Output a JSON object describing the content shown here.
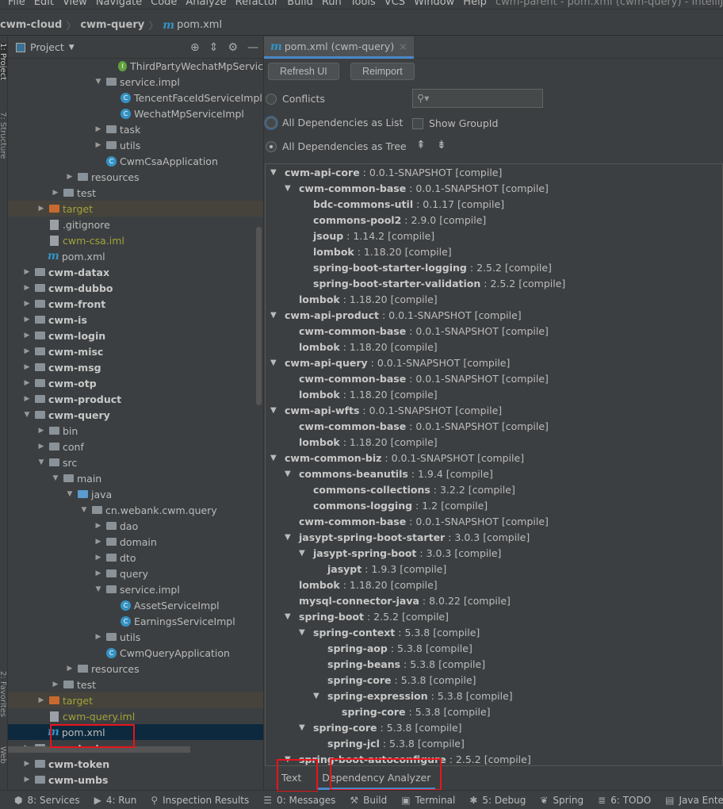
{
  "menu": {
    "items": [
      "File",
      "Edit",
      "View",
      "Navigate",
      "Code",
      "Analyze",
      "Refactor",
      "Build",
      "Run",
      "Tools",
      "VCS",
      "Window",
      "Help"
    ],
    "window_title": "cwm-parent - pom.xml (cwm-query) - IntelliJ IDEA"
  },
  "breadcrumb": [
    "cwm-cloud",
    "cwm-query",
    "pom.xml"
  ],
  "side_stripe": [
    "1: Project",
    "7: Structure",
    "2: Favorites",
    "Web"
  ],
  "project": {
    "title": "Project",
    "rows": [
      {
        "d": 7,
        "t": "iface",
        "label": "ThirdPartyWechatMpServic"
      },
      {
        "d": 6,
        "t": "folder",
        "open": true,
        "label": "service.impl"
      },
      {
        "d": 7,
        "t": "class",
        "label": "TencentFaceIdServiceImpl"
      },
      {
        "d": 7,
        "t": "class",
        "label": "WechatMpServiceImpl"
      },
      {
        "d": 6,
        "t": "folder",
        "open": false,
        "label": "task"
      },
      {
        "d": 6,
        "t": "folder",
        "open": false,
        "label": "utils"
      },
      {
        "d": 6,
        "t": "app",
        "label": "CwmCsaApplication"
      },
      {
        "d": 4,
        "t": "folder",
        "open": false,
        "label": "resources"
      },
      {
        "d": 3,
        "t": "folder",
        "open": false,
        "label": "test"
      },
      {
        "d": 2,
        "t": "target",
        "open": false,
        "label": "target"
      },
      {
        "d": 2,
        "t": "file",
        "label": ".gitignore"
      },
      {
        "d": 2,
        "t": "iml",
        "label": "cwm-csa.iml"
      },
      {
        "d": 2,
        "t": "pom",
        "label": "pom.xml"
      },
      {
        "d": 1,
        "t": "module",
        "open": false,
        "label": "cwm-datax"
      },
      {
        "d": 1,
        "t": "module",
        "open": false,
        "label": "cwm-dubbo"
      },
      {
        "d": 1,
        "t": "module",
        "open": false,
        "label": "cwm-front"
      },
      {
        "d": 1,
        "t": "module",
        "open": false,
        "label": "cwm-is"
      },
      {
        "d": 1,
        "t": "module",
        "open": false,
        "label": "cwm-login"
      },
      {
        "d": 1,
        "t": "module",
        "open": false,
        "label": "cwm-misc"
      },
      {
        "d": 1,
        "t": "module",
        "open": false,
        "label": "cwm-msg"
      },
      {
        "d": 1,
        "t": "module",
        "open": false,
        "label": "cwm-otp"
      },
      {
        "d": 1,
        "t": "module",
        "open": false,
        "label": "cwm-product"
      },
      {
        "d": 1,
        "t": "module",
        "open": true,
        "label": "cwm-query"
      },
      {
        "d": 2,
        "t": "folder",
        "open": false,
        "label": "bin"
      },
      {
        "d": 2,
        "t": "folder",
        "open": false,
        "label": "conf"
      },
      {
        "d": 2,
        "t": "folder",
        "open": true,
        "label": "src"
      },
      {
        "d": 3,
        "t": "folder",
        "open": true,
        "label": "main"
      },
      {
        "d": 4,
        "t": "java",
        "open": true,
        "label": "java"
      },
      {
        "d": 5,
        "t": "folder",
        "open": true,
        "label": "cn.webank.cwm.query"
      },
      {
        "d": 6,
        "t": "folder",
        "open": false,
        "label": "dao"
      },
      {
        "d": 6,
        "t": "folder",
        "open": false,
        "label": "domain"
      },
      {
        "d": 6,
        "t": "folder",
        "open": false,
        "label": "dto"
      },
      {
        "d": 6,
        "t": "folder",
        "open": false,
        "label": "query"
      },
      {
        "d": 6,
        "t": "folder",
        "open": true,
        "label": "service.impl"
      },
      {
        "d": 7,
        "t": "class",
        "label": "AssetServiceImpl"
      },
      {
        "d": 7,
        "t": "class",
        "label": "EarningsServiceImpl"
      },
      {
        "d": 6,
        "t": "folder",
        "open": false,
        "label": "utils"
      },
      {
        "d": 6,
        "t": "app",
        "label": "CwmQueryApplication"
      },
      {
        "d": 4,
        "t": "folder",
        "open": false,
        "label": "resources"
      },
      {
        "d": 3,
        "t": "folder",
        "open": false,
        "label": "test"
      },
      {
        "d": 2,
        "t": "target",
        "open": false,
        "label": "target"
      },
      {
        "d": 2,
        "t": "iml",
        "label": "cwm-query.iml"
      },
      {
        "d": 2,
        "t": "pom",
        "label": "pom.xml",
        "selected": true
      },
      {
        "d": 1,
        "t": "module",
        "open": false,
        "label": "cwm-test"
      },
      {
        "d": 1,
        "t": "module",
        "open": false,
        "label": "cwm-token"
      },
      {
        "d": 1,
        "t": "module",
        "open": false,
        "label": "cwm-umbs"
      }
    ]
  },
  "editor": {
    "tab": "pom.xml (cwm-query)",
    "refresh": "Refresh UI",
    "reimport": "Reimport",
    "options": {
      "conflicts": "Conflicts",
      "list": "All Dependencies as List",
      "tree": "All Dependencies as Tree",
      "show_group": "Show GroupId"
    },
    "selected_option": "tree",
    "search_placeholder": "",
    "deps": [
      [
        0,
        1,
        "cwm-api-core",
        "0.0.1-SNAPSHOT"
      ],
      [
        1,
        1,
        "cwm-common-base",
        "0.0.1-SNAPSHOT"
      ],
      [
        2,
        0,
        "bdc-commons-util",
        "0.1.17"
      ],
      [
        2,
        0,
        "commons-pool2",
        "2.9.0"
      ],
      [
        2,
        0,
        "jsoup",
        "1.14.2"
      ],
      [
        2,
        0,
        "lombok",
        "1.18.20"
      ],
      [
        2,
        0,
        "spring-boot-starter-logging",
        "2.5.2"
      ],
      [
        2,
        0,
        "spring-boot-starter-validation",
        "2.5.2"
      ],
      [
        1,
        0,
        "lombok",
        "1.18.20"
      ],
      [
        0,
        1,
        "cwm-api-product",
        "0.0.1-SNAPSHOT"
      ],
      [
        1,
        0,
        "cwm-common-base",
        "0.0.1-SNAPSHOT"
      ],
      [
        1,
        0,
        "lombok",
        "1.18.20"
      ],
      [
        0,
        1,
        "cwm-api-query",
        "0.0.1-SNAPSHOT"
      ],
      [
        1,
        0,
        "cwm-common-base",
        "0.0.1-SNAPSHOT"
      ],
      [
        1,
        0,
        "lombok",
        "1.18.20"
      ],
      [
        0,
        1,
        "cwm-api-wfts",
        "0.0.1-SNAPSHOT"
      ],
      [
        1,
        0,
        "cwm-common-base",
        "0.0.1-SNAPSHOT"
      ],
      [
        1,
        0,
        "lombok",
        "1.18.20"
      ],
      [
        0,
        1,
        "cwm-common-biz",
        "0.0.1-SNAPSHOT"
      ],
      [
        1,
        1,
        "commons-beanutils",
        "1.9.4"
      ],
      [
        2,
        0,
        "commons-collections",
        "3.2.2"
      ],
      [
        2,
        0,
        "commons-logging",
        "1.2"
      ],
      [
        1,
        0,
        "cwm-common-base",
        "0.0.1-SNAPSHOT"
      ],
      [
        1,
        1,
        "jasypt-spring-boot-starter",
        "3.0.3"
      ],
      [
        2,
        1,
        "jasypt-spring-boot",
        "3.0.3"
      ],
      [
        3,
        0,
        "jasypt",
        "1.9.3"
      ],
      [
        1,
        0,
        "lombok",
        "1.18.20"
      ],
      [
        1,
        0,
        "mysql-connector-java",
        "8.0.22"
      ],
      [
        1,
        1,
        "spring-boot",
        "2.5.2"
      ],
      [
        2,
        1,
        "spring-context",
        "5.3.8"
      ],
      [
        3,
        0,
        "spring-aop",
        "5.3.8"
      ],
      [
        3,
        0,
        "spring-beans",
        "5.3.8"
      ],
      [
        3,
        0,
        "spring-core",
        "5.3.8"
      ],
      [
        3,
        1,
        "spring-expression",
        "5.3.8"
      ],
      [
        4,
        0,
        "spring-core",
        "5.3.8"
      ],
      [
        2,
        1,
        "spring-core",
        "5.3.8"
      ],
      [
        3,
        0,
        "spring-jcl",
        "5.3.8"
      ],
      [
        1,
        1,
        "spring-boot-autoconfigure",
        "2.5.2"
      ]
    ],
    "scope": "[compile]",
    "bottom_tabs": [
      "Text",
      "Dependency Analyzer"
    ],
    "active_bottom_tab": "Dependency Analyzer"
  },
  "statusbar": [
    {
      "icon": "services-icon",
      "g": "⬢",
      "label": "8: Services"
    },
    {
      "icon": "run-icon",
      "g": "▶",
      "label": "4: Run"
    },
    {
      "icon": "inspection-icon",
      "g": "⚲",
      "label": "Inspection Results"
    },
    {
      "icon": "messages-icon",
      "g": "☰",
      "label": "0: Messages"
    },
    {
      "icon": "build-icon",
      "g": "⚒",
      "label": "Build"
    },
    {
      "icon": "terminal-icon",
      "g": "▣",
      "label": "Terminal"
    },
    {
      "icon": "debug-icon",
      "g": "✱",
      "label": "5: Debug"
    },
    {
      "icon": "spring-icon",
      "g": "❦",
      "label": "Spring"
    },
    {
      "icon": "todo-icon",
      "g": "≣",
      "label": "6: TODO"
    },
    {
      "icon": "java-enterprise-icon",
      "g": "▤",
      "label": "Java Enterprise"
    }
  ],
  "colors": {
    "accent": "#4a88c7",
    "highlight_box": "#e8141b",
    "selected_row": "#0d293e",
    "target_row": "#45433b"
  }
}
